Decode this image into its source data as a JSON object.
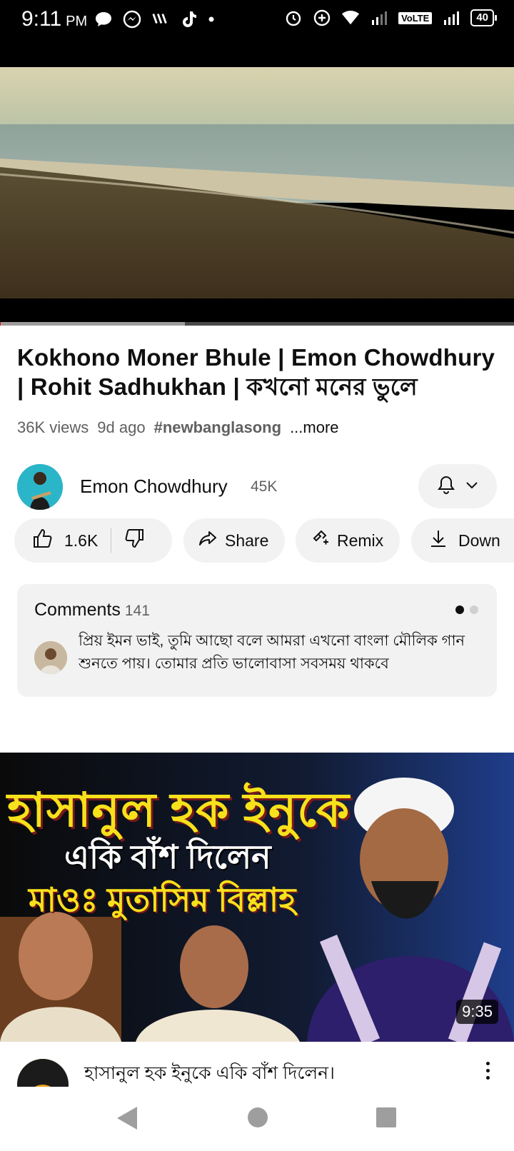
{
  "status_bar": {
    "time": "9:11",
    "ampm": "PM",
    "left_icons": [
      "chat-bubble-icon",
      "messenger-icon",
      "wifi-calling-icon",
      "tiktok-icon",
      "more-dot-icon"
    ],
    "right_icons": [
      "alarm-icon",
      "data-saver-icon",
      "wifi-icon",
      "signal-icon",
      "volte-badge",
      "signal-2-icon",
      "battery-icon"
    ],
    "volte": "VoLTE",
    "battery": "40"
  },
  "player": {
    "progress": 0.002,
    "buffered": 0.36,
    "colors": {
      "played": "#ff0000",
      "buffered": "#9e9e9e",
      "track": "#4a4a4a"
    }
  },
  "video": {
    "title": "Kokhono Moner Bhule | Emon Chowdhury | Rohit Sadhukhan | কখনো মনের ভুলে",
    "views": "36K views",
    "age": "9d ago",
    "hashtag": "#newbanglasong",
    "more": "...more"
  },
  "channel": {
    "name": "Emon Chowdhury",
    "subscribers": "45K",
    "bell_icon": "bell-icon",
    "chevron_icon": "chevron-down-icon"
  },
  "actions": {
    "likes": "1.6K",
    "share": "Share",
    "remix": "Remix",
    "download": "Down"
  },
  "comments": {
    "label": "Comments",
    "count": "141",
    "top_comment": "প্রিয় ইমন ভাই, তুমি আছো বলে আমরা এখনো বাংলা মৌলিক গান শুনতে পায়। তোমার প্রতি ভালোবাসা সবসময় থাকবে"
  },
  "next_video": {
    "thumb_line1": "হাসানুল হক ইনুকে",
    "thumb_line2": "একি বাঁশ দিলেন",
    "thumb_line3": "মাওঃ মুতাসিম বিল্লাহ",
    "duration": "9:35",
    "title": "হাসানুল হক ইনুকে  একি বাঁশ দিলেন।"
  },
  "nav": [
    "back-icon",
    "home-icon",
    "recents-icon"
  ]
}
